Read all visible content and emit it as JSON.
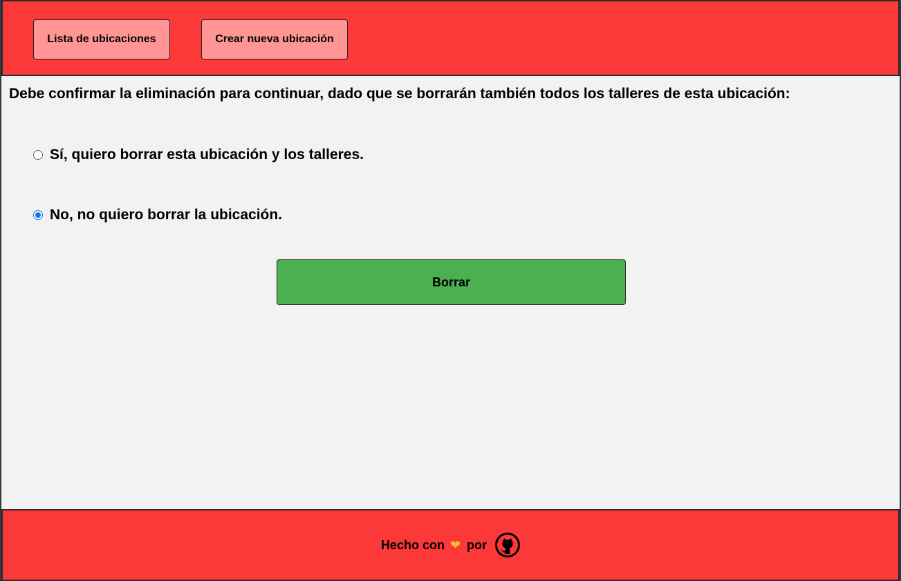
{
  "header": {
    "nav": {
      "list_label": "Lista de ubicaciones",
      "create_label": "Crear nueva ubicación"
    }
  },
  "main": {
    "prompt": "Debe confirmar la eliminación para continuar, dado que se borrarán también todos los talleres de esta ubicación:",
    "options": [
      {
        "label": "Sí, quiero borrar esta ubicación y los talleres.",
        "selected": false
      },
      {
        "label": "No, no quiero borrar la ubicación.",
        "selected": true
      }
    ],
    "submit_label": "Borrar"
  },
  "footer": {
    "made_with": "Hecho con",
    "heart_icon": "yellow-heart-icon",
    "by": "por",
    "github_icon": "github-icon"
  },
  "colors": {
    "header_bg": "#fc3838",
    "nav_button_bg": "#ff9595",
    "submit_bg": "#4caf50",
    "radio_accent": "#1a73e8"
  }
}
